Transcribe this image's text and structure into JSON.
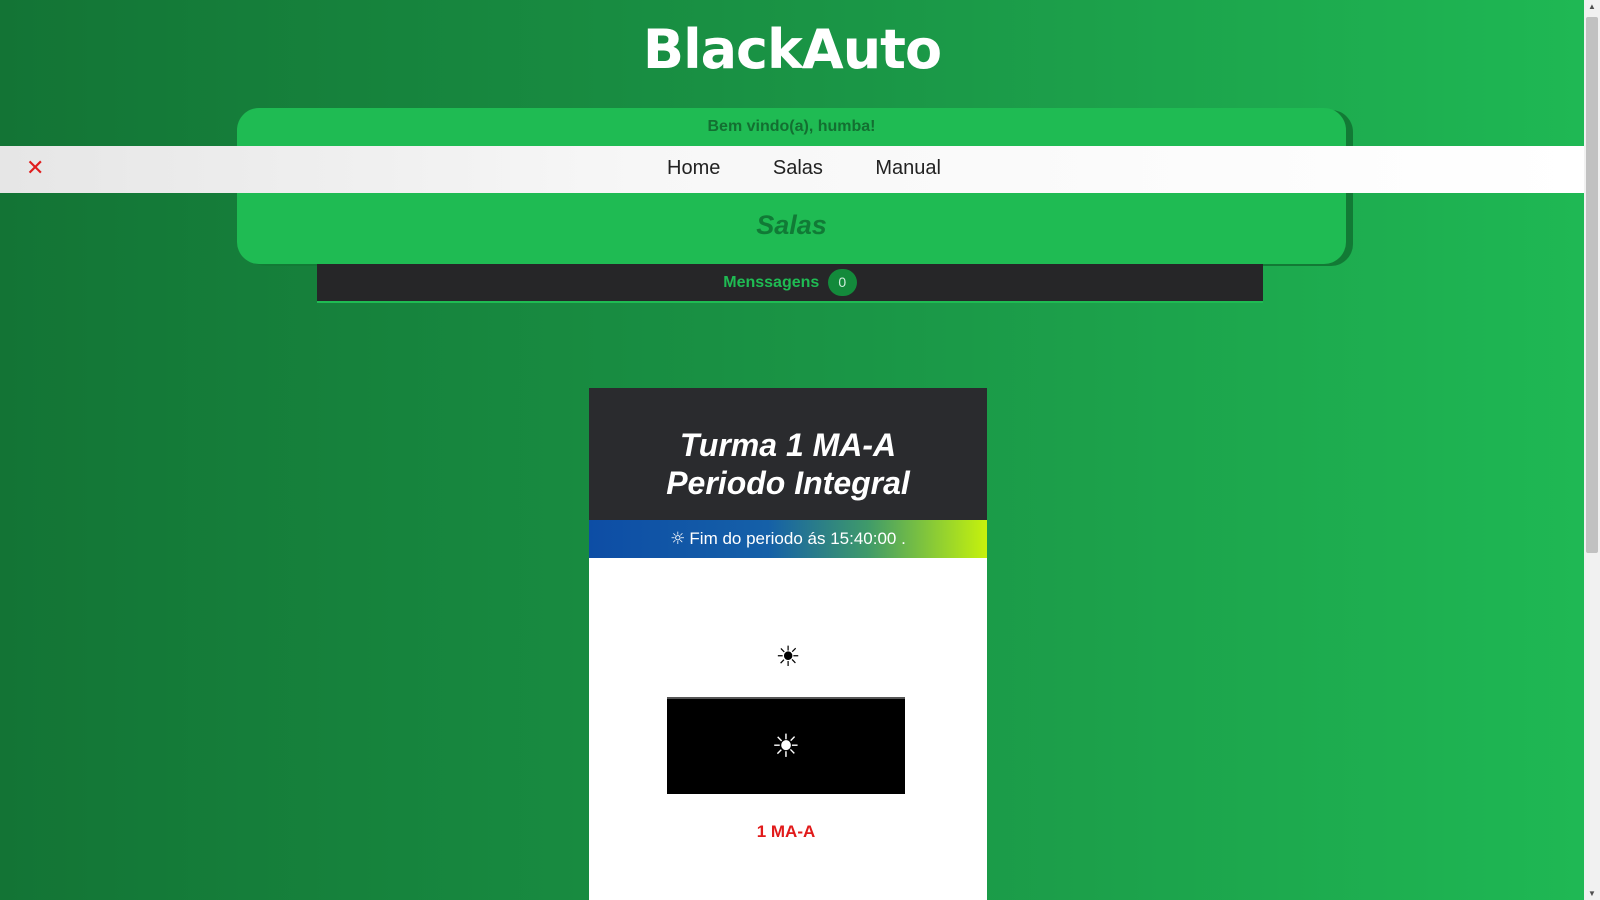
{
  "brand": {
    "logo_text": "BlackAuto"
  },
  "welcome": {
    "greeting": "Bem vindo(a), humba!",
    "heading": "Salas"
  },
  "nav": {
    "close_glyph": "✕",
    "items": [
      {
        "label": "Home"
      },
      {
        "label": "Salas"
      },
      {
        "label": "Manual"
      }
    ]
  },
  "messages": {
    "label": "Menssagens",
    "count": "0"
  },
  "class_card": {
    "title_line1": "Turma 1 MA-A",
    "title_line2": "Periodo Integral",
    "period_icon": "☼",
    "period_text": "Fim do periodo ás 15:40:00 .",
    "sun_icon": "☀",
    "box_sun_icon": "☀",
    "code": "1 MA-A"
  },
  "colors": {
    "background_start": "#137435",
    "background_end": "#1fb954",
    "card_green": "#1fbb53",
    "dark": "#262628",
    "accent_red": "#e11a1a"
  },
  "icons": {
    "close": "close-icon",
    "period": "sun-outline-icon",
    "sun": "sun-icon"
  }
}
